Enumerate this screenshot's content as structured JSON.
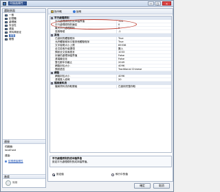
{
  "window": {
    "title": "伺服器屬性 -",
    "min_label": "—",
    "max_label": "□",
    "close_label": "✕"
  },
  "left": {
    "header": "選取頁面",
    "pages": [
      {
        "label": "一般",
        "selected": false
      },
      {
        "label": "記憶體",
        "selected": false
      },
      {
        "label": "處理器",
        "selected": false
      },
      {
        "label": "安全性",
        "selected": false
      },
      {
        "label": "連接",
        "selected": false
      },
      {
        "label": "資料庫設定",
        "selected": false
      },
      {
        "label": "進階",
        "selected": true
      },
      {
        "label": "權限",
        "selected": false
      }
    ],
    "connection": {
      "header": "連接",
      "server_label": "伺服器:",
      "server_value": "localhost",
      "conn_label": "連接:",
      "link": "檢視連接屬性"
    },
    "progress": {
      "header": "進度",
      "status": "就緒"
    }
  },
  "toolbar": {
    "script": "指令碼",
    "help": "說明"
  },
  "grid": {
    "categories": [
      {
        "name": "平行處理原則",
        "rows": [
          {
            "name": "平行處理原則的成本臨界值",
            "value": "700"
          },
          {
            "name": "平行處理原則的鎖定",
            "value": "0"
          },
          {
            "name": "最大平行處理原則",
            "value": "0"
          },
          {
            "name": "查詢等候",
            "value": "-1"
          }
        ]
      },
      {
        "name": "其他",
        "rows": [
          {
            "name": "已啟用的觸發程序",
            "value": "True"
          },
          {
            "name": "允許觸發程序引發其他觸發程序",
            "value": "True"
          },
          {
            "name": "文字複寫大小上限",
            "value": "65536"
          },
          {
            "name": "全文檢索升級選項",
            "value": "匯入"
          },
          {
            "name": "預設全文檢索語言",
            "value": "1033"
          },
          {
            "name": "封鎖的處理序臨界值",
            "value": "False"
          },
          {
            "name": "遠端最佳化",
            "value": "False"
          },
          {
            "name": "雙位數年份截止",
            "value": "2049"
          },
          {
            "name": "網路封包大小",
            "value": "4096"
          },
          {
            "name": "預設語言",
            "value": "Traditional Chinese"
          }
        ]
      },
      {
        "name": "網路",
        "rows": [
          {
            "name": "網路封包大小",
            "value": "4096"
          },
          {
            "name": "遠端登入逾時",
            "value": "20"
          }
        ]
      },
      {
        "name": "檔案資料流",
        "rows": [
          {
            "name": "檔案資料流存取層級",
            "value": "已啟用完整存取"
          }
        ]
      }
    ]
  },
  "description": {
    "title": "平行處理原則的成本臨界值",
    "text": "設定平行處理原則的成本臨界值。"
  },
  "radios": [
    {
      "label": "設定值",
      "checked": true
    },
    {
      "label": "執行中的值",
      "checked": false
    }
  ],
  "buttons": {
    "ok": "確定",
    "cancel": "取消"
  }
}
